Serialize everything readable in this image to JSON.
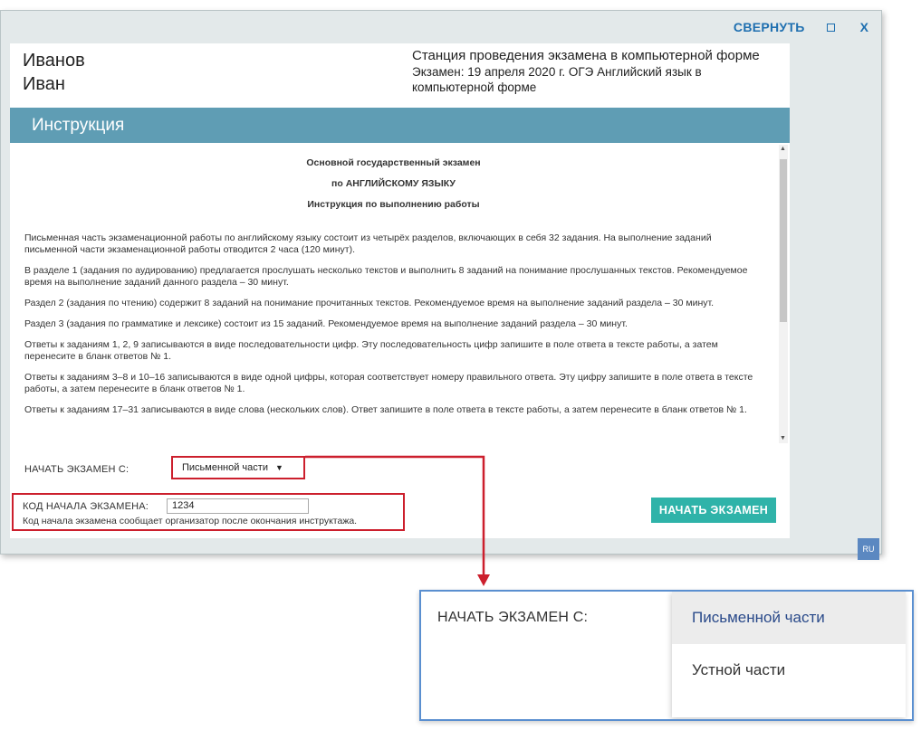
{
  "window": {
    "minimize_label": "СВЕРНУТЬ",
    "close_label": "X",
    "lang": "RU"
  },
  "student": {
    "surname": "Иванов",
    "name": "Иван"
  },
  "station": {
    "title": "Станция проведения экзамена в компьютерной форме",
    "exam": "Экзамен: 19 апреля 2020 г. ОГЭ Английский язык в компьютерной форме"
  },
  "banner": {
    "title": "Инструкция"
  },
  "instruction": {
    "heading1": "Основной государственный экзамен",
    "heading2": "по АНГЛИЙСКОМУ ЯЗЫКУ",
    "heading3": "Инструкция по выполнению работы",
    "paragraphs": [
      "Письменная часть экзаменационной работы по английскому языку состоит из четырёх разделов, включающих в себя 32 задания. На выполнение заданий письменной части экзаменационной работы отводится 2 часа (120 минут).",
      "В разделе 1 (задания по аудированию) предлагается прослушать несколько текстов и выполнить 8 заданий на понимание прослушанных текстов. Рекомендуемое время на выполнение заданий данного раздела – 30 минут.",
      "Раздел 2 (задания по чтению) содержит 8 заданий на понимание прочитанных текстов. Рекомендуемое время на выполнение заданий раздела – 30 минут.",
      "Раздел 3 (задания по грамматике и лексике) состоит из 15 заданий. Рекомендуемое время на выполнение заданий раздела – 30 минут.",
      "Ответы к заданиям 1, 2, 9 записываются в виде последовательности цифр. Эту последовательность цифр запишите в поле ответа в тексте работы, а затем перенесите в бланк ответов № 1.",
      "Ответы к заданиям 3–8 и 10–16 записываются в виде одной цифры, которая соответствует номеру правильного ответа. Эту цифру запишите в поле ответа в тексте работы, а затем перенесите в бланк ответов № 1.",
      "Ответы к заданиям 17–31 записываются в виде слова (нескольких слов). Ответ запишите в поле ответа в тексте работы, а затем перенесите в бланк ответов № 1."
    ]
  },
  "start": {
    "label": "НАЧАТЬ ЭКЗАМЕН С:",
    "selected": "Письменной части",
    "arrow": "▼"
  },
  "code": {
    "label": "КОД НАЧАЛА ЭКЗАМЕНА:",
    "value": "1234",
    "note": "Код начала экзамена сообщает организатор после окончания инструктажа."
  },
  "start_button": "НАЧАТЬ ЭКЗАМЕН",
  "zoom": {
    "label": "НАЧАТЬ ЭКЗАМЕН С:",
    "options": [
      "Письменной части",
      "Устной части"
    ]
  },
  "colors": {
    "accent_red": "#cc1f2d",
    "banner": "#5f9db4",
    "button": "#2fb3a9",
    "window_link": "#1e6fb0"
  }
}
